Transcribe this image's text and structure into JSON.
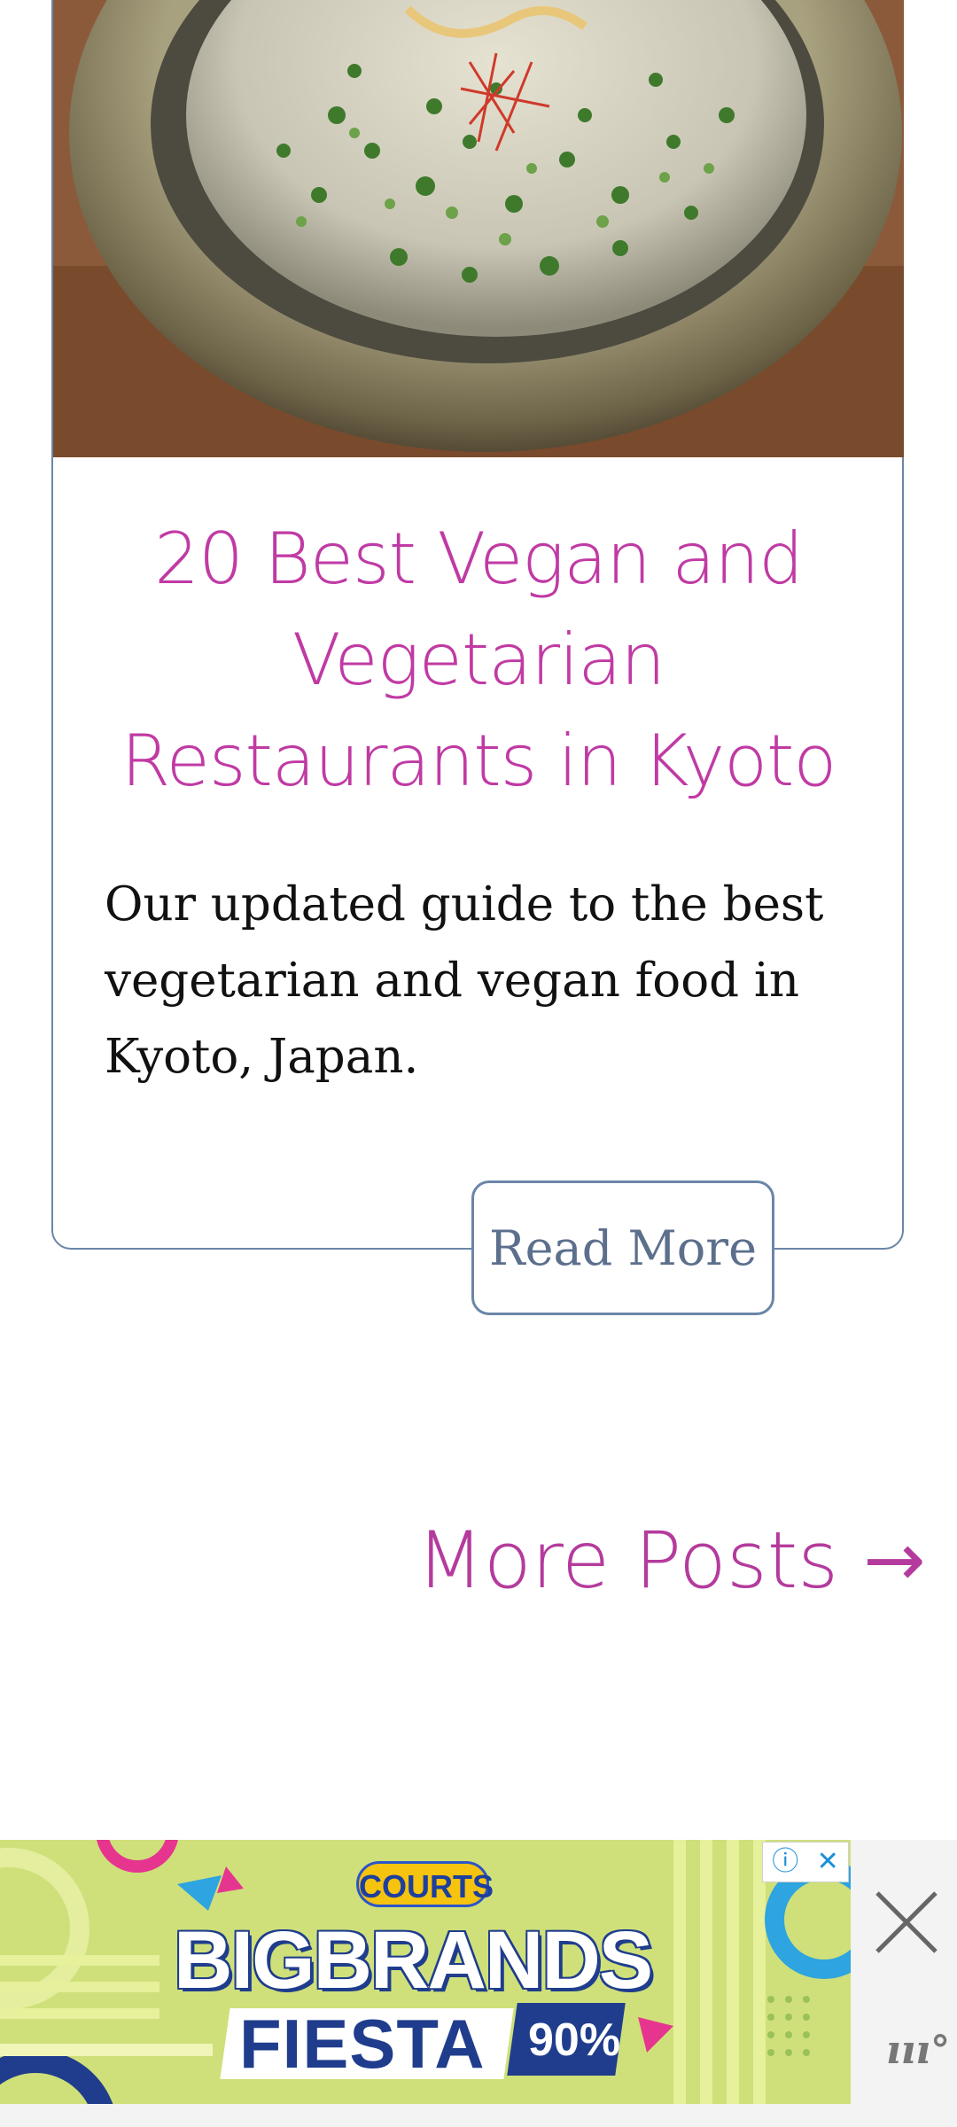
{
  "post": {
    "title": "20 Best Vegan and Vegetarian Restaurants in Kyoto",
    "excerpt": "Our updated guide to the best vegetarian and vegan food in Kyoto, Japan.",
    "read_more_label": "Read More"
  },
  "pagination": {
    "more_posts_label": "More Posts",
    "arrow": "→"
  },
  "ad": {
    "brand": "COURTS",
    "headline": "BIGBRANDS",
    "subheadline": "FIESTA",
    "discount": "90%",
    "choices_info": "ⓘ",
    "choices_close": "✕",
    "brand_mark": "ııı°"
  },
  "colors": {
    "accent_pink": "#c03aa4",
    "card_border": "#6b86a8",
    "ad_green": "#cfe07a",
    "ad_navy": "#1f3d8c"
  }
}
